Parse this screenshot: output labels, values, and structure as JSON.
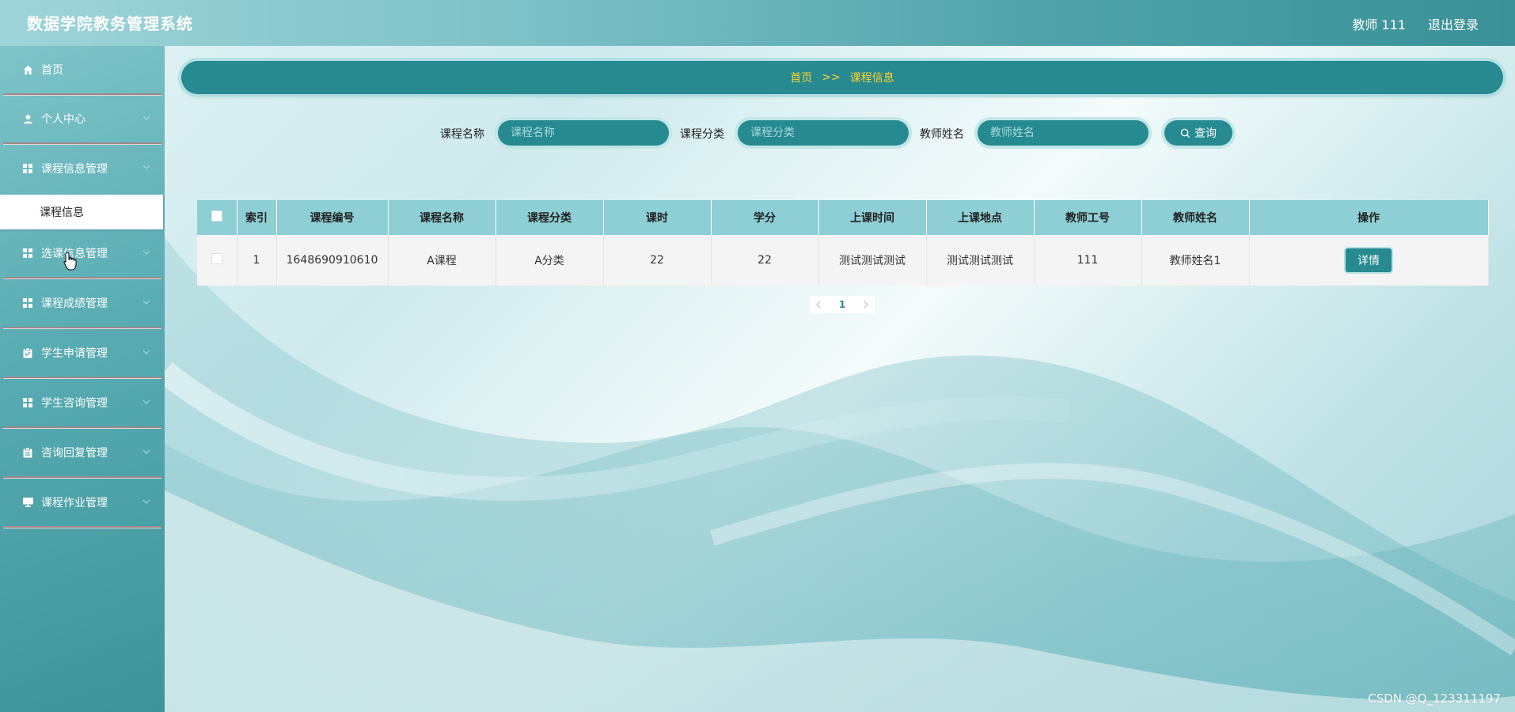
{
  "header": {
    "title": "数据学院教务管理系统",
    "user": "教师 111",
    "logout": "退出登录"
  },
  "sidebar": {
    "items": [
      {
        "label": "首页",
        "icon": "home-icon"
      },
      {
        "label": "个人中心",
        "icon": "user-icon"
      },
      {
        "label": "课程信息管理",
        "icon": "grid-icon"
      },
      {
        "label": "选课信息管理",
        "icon": "grid-icon"
      },
      {
        "label": "课程成绩管理",
        "icon": "grid-icon"
      },
      {
        "label": "学生申请管理",
        "icon": "clipboard-icon"
      },
      {
        "label": "学生咨询管理",
        "icon": "grid-icon"
      },
      {
        "label": "咨询回复管理",
        "icon": "clipboard-icon"
      },
      {
        "label": "课程作业管理",
        "icon": "monitor-icon"
      }
    ],
    "active_sub": "课程信息"
  },
  "breadcrumb": {
    "home": "首页",
    "sep": ">>",
    "current": "课程信息"
  },
  "search": {
    "course_name_label": "课程名称",
    "course_name_placeholder": "课程名称",
    "course_type_label": "课程分类",
    "course_type_placeholder": "课程分类",
    "teacher_name_label": "教师姓名",
    "teacher_name_placeholder": "教师姓名",
    "query_label": "查询"
  },
  "table": {
    "headers": [
      "索引",
      "课程编号",
      "课程名称",
      "课程分类",
      "课时",
      "学分",
      "上课时间",
      "上课地点",
      "教师工号",
      "教师姓名",
      "操作"
    ],
    "rows": [
      {
        "index": "1",
        "course_no": "1648690910610",
        "course_name": "A课程",
        "course_type": "A分类",
        "hours": "22",
        "credits": "22",
        "time": "测试测试测试",
        "place": "测试测试测试",
        "teacher_no": "111",
        "teacher_name": "教师姓名1",
        "action": "详情"
      }
    ]
  },
  "pagination": {
    "current": "1"
  },
  "watermark": "CSDN @Q_123311197",
  "colors": {
    "primary": "#268a90",
    "breadcrumb_text": "#ffd233",
    "table_header": "#8dcfd4"
  }
}
